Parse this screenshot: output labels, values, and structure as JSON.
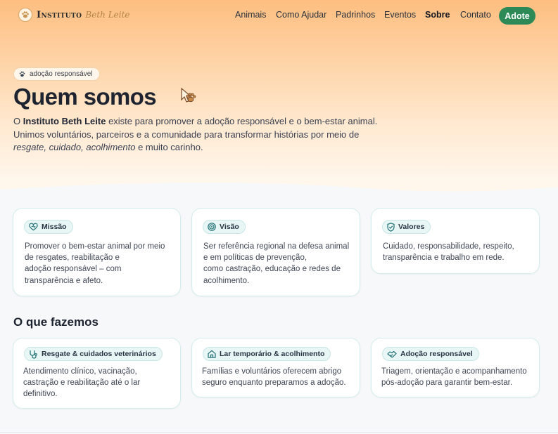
{
  "nav": {
    "logo_name": "Instituto",
    "logo_script": "Beth Leite",
    "links": [
      "Animais",
      "Como Ajudar",
      "Padrinhos",
      "Eventos",
      "Sobre",
      "Contato"
    ],
    "active": "Sobre",
    "cta": "Adote"
  },
  "hero": {
    "tag": "adoção responsável",
    "title": "Quem somos",
    "intro_prefix": "O ",
    "intro_org": "Instituto Beth Leite",
    "intro_line1": " existe para promover a adoção responsável e o bem-estar animal.",
    "intro_line2": "Unimos voluntários, parceiros e a comunidade para transformar histórias por meio de",
    "intro_italic": "resgate, cuidado, acolhimento",
    "intro_end": " e muito carinho."
  },
  "about_cards": [
    {
      "icon": "heart-icon",
      "label": "Missão",
      "lines": [
        "Promover o bem-estar animal por meio",
        "de resgates, reabilitação e",
        "adoção responsável – com",
        "transparência e afeto."
      ]
    },
    {
      "icon": "target-icon",
      "label": "Visão",
      "lines": [
        "Ser referência regional na defesa animal",
        "e em políticas de prevenção,",
        "como castração, educação e redes de",
        "acolhimento."
      ]
    },
    {
      "icon": "shield-check-icon",
      "label": "Valores",
      "lines": [
        "Cuidado, responsabilidade, respeito,",
        "transparência e trabalho em rede."
      ]
    }
  ],
  "what_we_do": {
    "title": "O que fazemos",
    "cards": [
      {
        "icon": "stethoscope-icon",
        "label": "Resgate & cuidados veterinários",
        "lines": [
          "Atendimento clínico, vacinação,",
          "castração e reabilitação até o lar",
          "definitivo."
        ]
      },
      {
        "icon": "home-icon",
        "label": "Lar temporário & acolhimento",
        "lines": [
          "Famílias e voluntários oferecem abrigo",
          "seguro enquanto preparamos a adoção."
        ]
      },
      {
        "icon": "handshake-icon",
        "label": "Adoção responsável",
        "lines": [
          "Triagem, orientação e acompanhamento",
          "pós-adoção para garantir bem-estar."
        ]
      }
    ]
  },
  "colors": {
    "accent": "#2d8a57",
    "hero_top": "#fdbe80",
    "chip_bg": "#e9f6f6"
  }
}
